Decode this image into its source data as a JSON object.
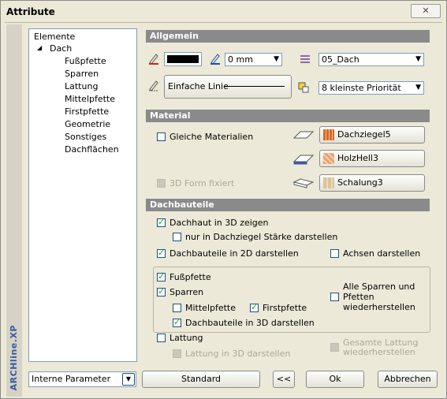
{
  "window": {
    "title": "Attribute",
    "close_label": "✕"
  },
  "brand": "ARCHline.XP",
  "tree": {
    "root": "Elemente",
    "node": "Dach",
    "toggle": "◢",
    "children": [
      "Fußpfette",
      "Sparren",
      "Lattung",
      "Mittelpfette",
      "Firstpfette",
      "Geometrie",
      "Sonstiges",
      "Dachflächen"
    ]
  },
  "allgemein": {
    "header": "Allgemein",
    "line_width": "0 mm",
    "layer": "05_Dach",
    "line_style": "Einfache Linie",
    "priority": "8 kleinste Priorität",
    "pen_color": "#000000"
  },
  "material": {
    "header": "Material",
    "same_materials": "Gleiche Materialien",
    "form_fixed": "3D Form fixiert",
    "m1": "Dachziegel5",
    "m2": "HolzHell3",
    "m3": "Schalung3",
    "m1_color": "#d9682a",
    "m2_color": "#e8a070",
    "m3_color": "#d9c49a"
  },
  "dachbauteile": {
    "header": "Dachbauteile",
    "dachhaut_3d": "Dachhaut in 3D zeigen",
    "nur_dachziegel": "nur in Dachziegel Stärke darstellen",
    "bauteile_2d": "Dachbauteile in 2D darstellen",
    "achsen": "Achsen darstellen",
    "fusspfette": "Fußpfette",
    "sparren": "Sparren",
    "alle_sparren": "Alle Sparren und Pfetten wiederherstellen",
    "mittelpfette": "Mittelpfette",
    "firstpfette": "Firstpfette",
    "bauteile_3d": "Dachbauteile in 3D darstellen",
    "lattung": "Lattung",
    "lattung_3d": "Lattung in 3D darstellen",
    "gesamte_lattung": "Gesamte Lattung wiederherstellen"
  },
  "footer": {
    "params": "Interne Parameter",
    "standard": "Standard",
    "back": "<<",
    "ok": "Ok",
    "cancel": "Abbrechen"
  }
}
